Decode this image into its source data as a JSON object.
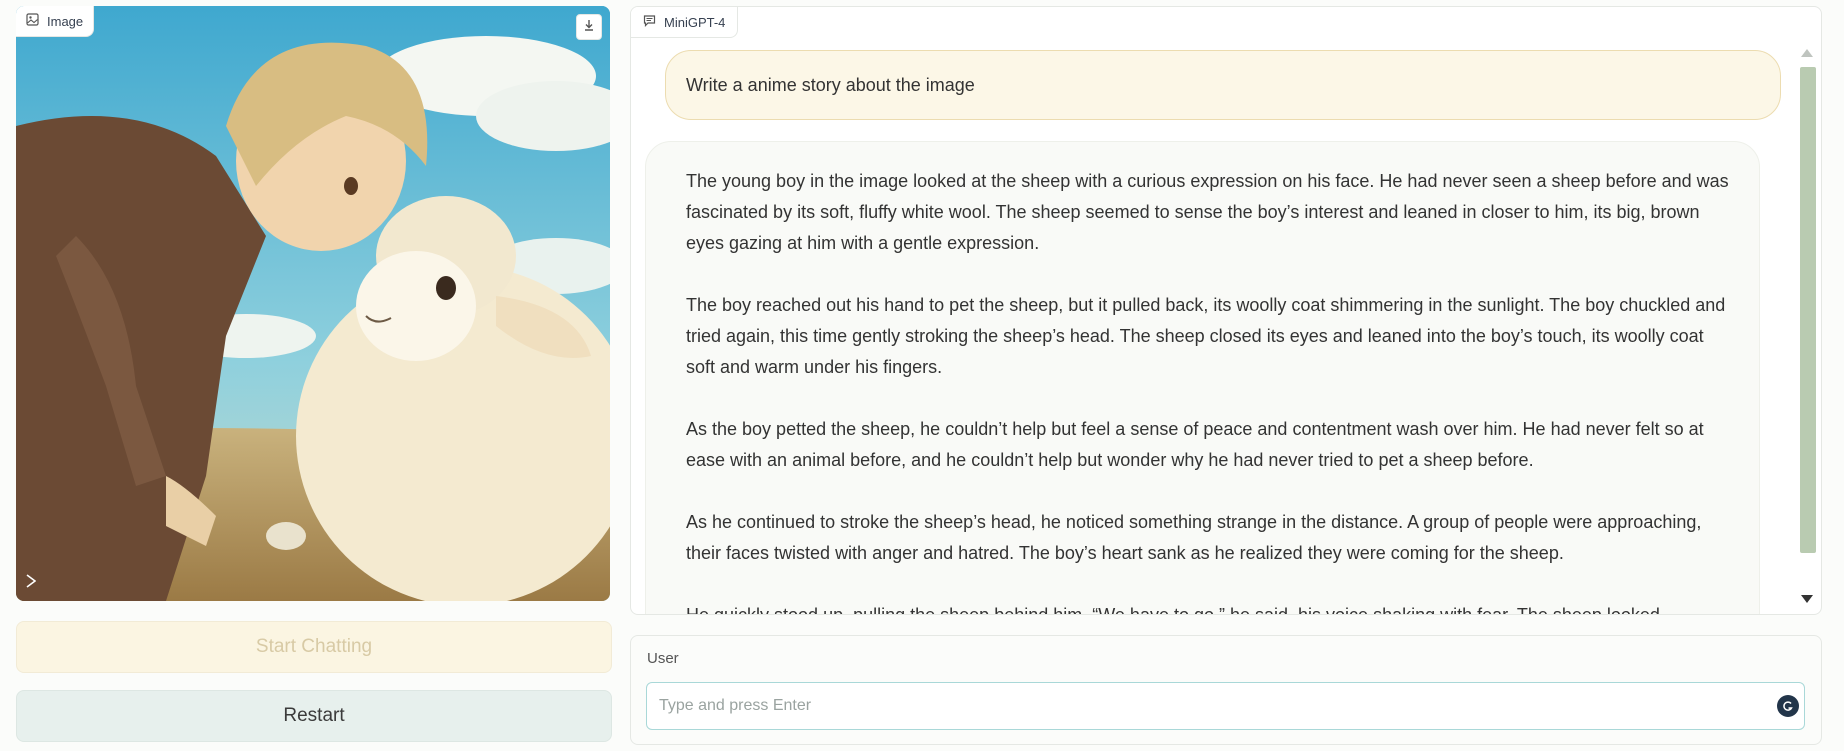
{
  "image_panel": {
    "label": "Image",
    "label_icon": "image-icon",
    "download_icon": "download-icon"
  },
  "buttons": {
    "start_chatting": "Start Chatting",
    "restart": "Restart"
  },
  "chat": {
    "label": "MiniGPT-4",
    "label_icon": "chat-icon",
    "user_message": "Write a anime story about the image",
    "bot_paragraphs": [
      "The young boy in the image looked at the sheep with a curious expression on his face. He had never seen a sheep before and was fascinated by its soft, fluffy white wool. The sheep seemed to sense the boy’s interest and leaned in closer to him, its big, brown eyes gazing at him with a gentle expression.",
      "The boy reached out his hand to pet the sheep, but it pulled back, its woolly coat shimmering in the sunlight. The boy chuckled and tried again, this time gently stroking the sheep’s head. The sheep closed its eyes and leaned into the boy’s touch, its woolly coat soft and warm under his fingers.",
      "As the boy petted the sheep, he couldn’t help but feel a sense of peace and contentment wash over him. He had never felt so at ease with an animal before, and he couldn’t help but wonder why he had never tried to pet a sheep before.",
      "As he continued to stroke the sheep’s head, he noticed something strange in the distance. A group of people were approaching, their faces twisted with anger and hatred. The boy’s heart sank as he realized they were coming for the sheep.",
      "He quickly stood up, pulling the sheep behind him. “We have to go,” he said, his voice shaking with fear. The sheep looked"
    ]
  },
  "input": {
    "label": "User",
    "placeholder": "Type and press Enter",
    "value": ""
  },
  "colors": {
    "user_bubble": "#fcf7e7",
    "bot_bubble": "#f9faf7",
    "scroll_thumb": "#b9cbb1",
    "start_button": "#fbf5e2",
    "restart_button": "#e7f0ed"
  }
}
